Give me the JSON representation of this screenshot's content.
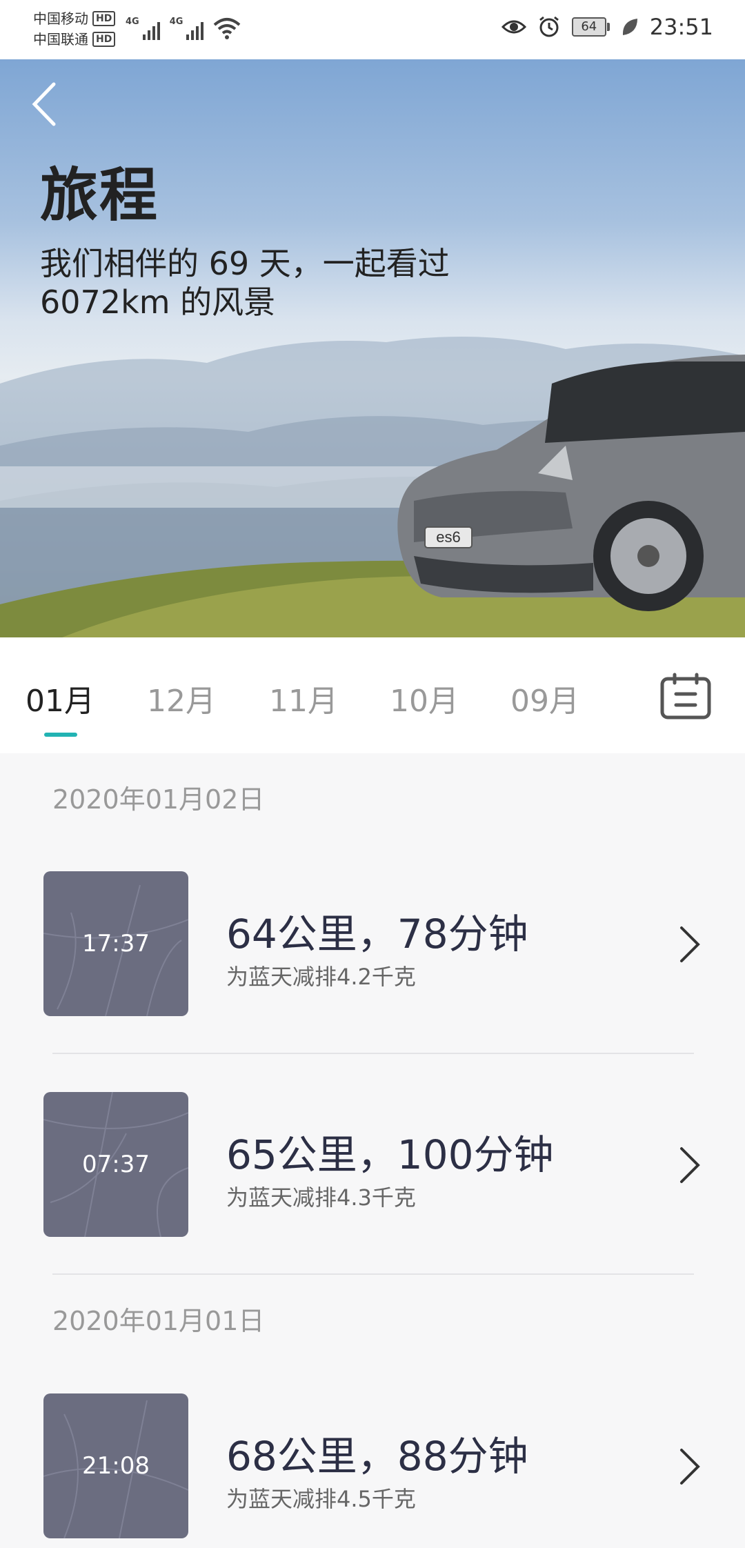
{
  "status_bar": {
    "carrier1": "中国移动",
    "carrier2": "中国联通",
    "hd": "HD",
    "network1": "4G",
    "network2": "4G",
    "battery": "64",
    "time": "23:51"
  },
  "hero": {
    "title": "旅程",
    "subtitle_line1": "我们相伴的 69 天，一起看过",
    "subtitle_line2": "6072km 的风景",
    "plate": "es6"
  },
  "tabs": [
    {
      "label": "01月",
      "active": true
    },
    {
      "label": "12月",
      "active": false
    },
    {
      "label": "11月",
      "active": false
    },
    {
      "label": "10月",
      "active": false
    },
    {
      "label": "09月",
      "active": false
    }
  ],
  "sections": [
    {
      "date": "2020年01月02日",
      "trips": [
        {
          "time": "17:37",
          "title": "64公里，78分钟",
          "subtitle": "为蓝天减排4.2千克"
        },
        {
          "time": "07:37",
          "title": "65公里，100分钟",
          "subtitle": "为蓝天减排4.3千克"
        }
      ]
    },
    {
      "date": "2020年01月01日",
      "trips": [
        {
          "time": "21:08",
          "title": "68公里，88分钟",
          "subtitle": "为蓝天减排4.5千克"
        }
      ]
    }
  ],
  "colors": {
    "accent": "#22b3b3",
    "thumb_bg": "#6b6d80",
    "title_text": "#2c2f45"
  }
}
